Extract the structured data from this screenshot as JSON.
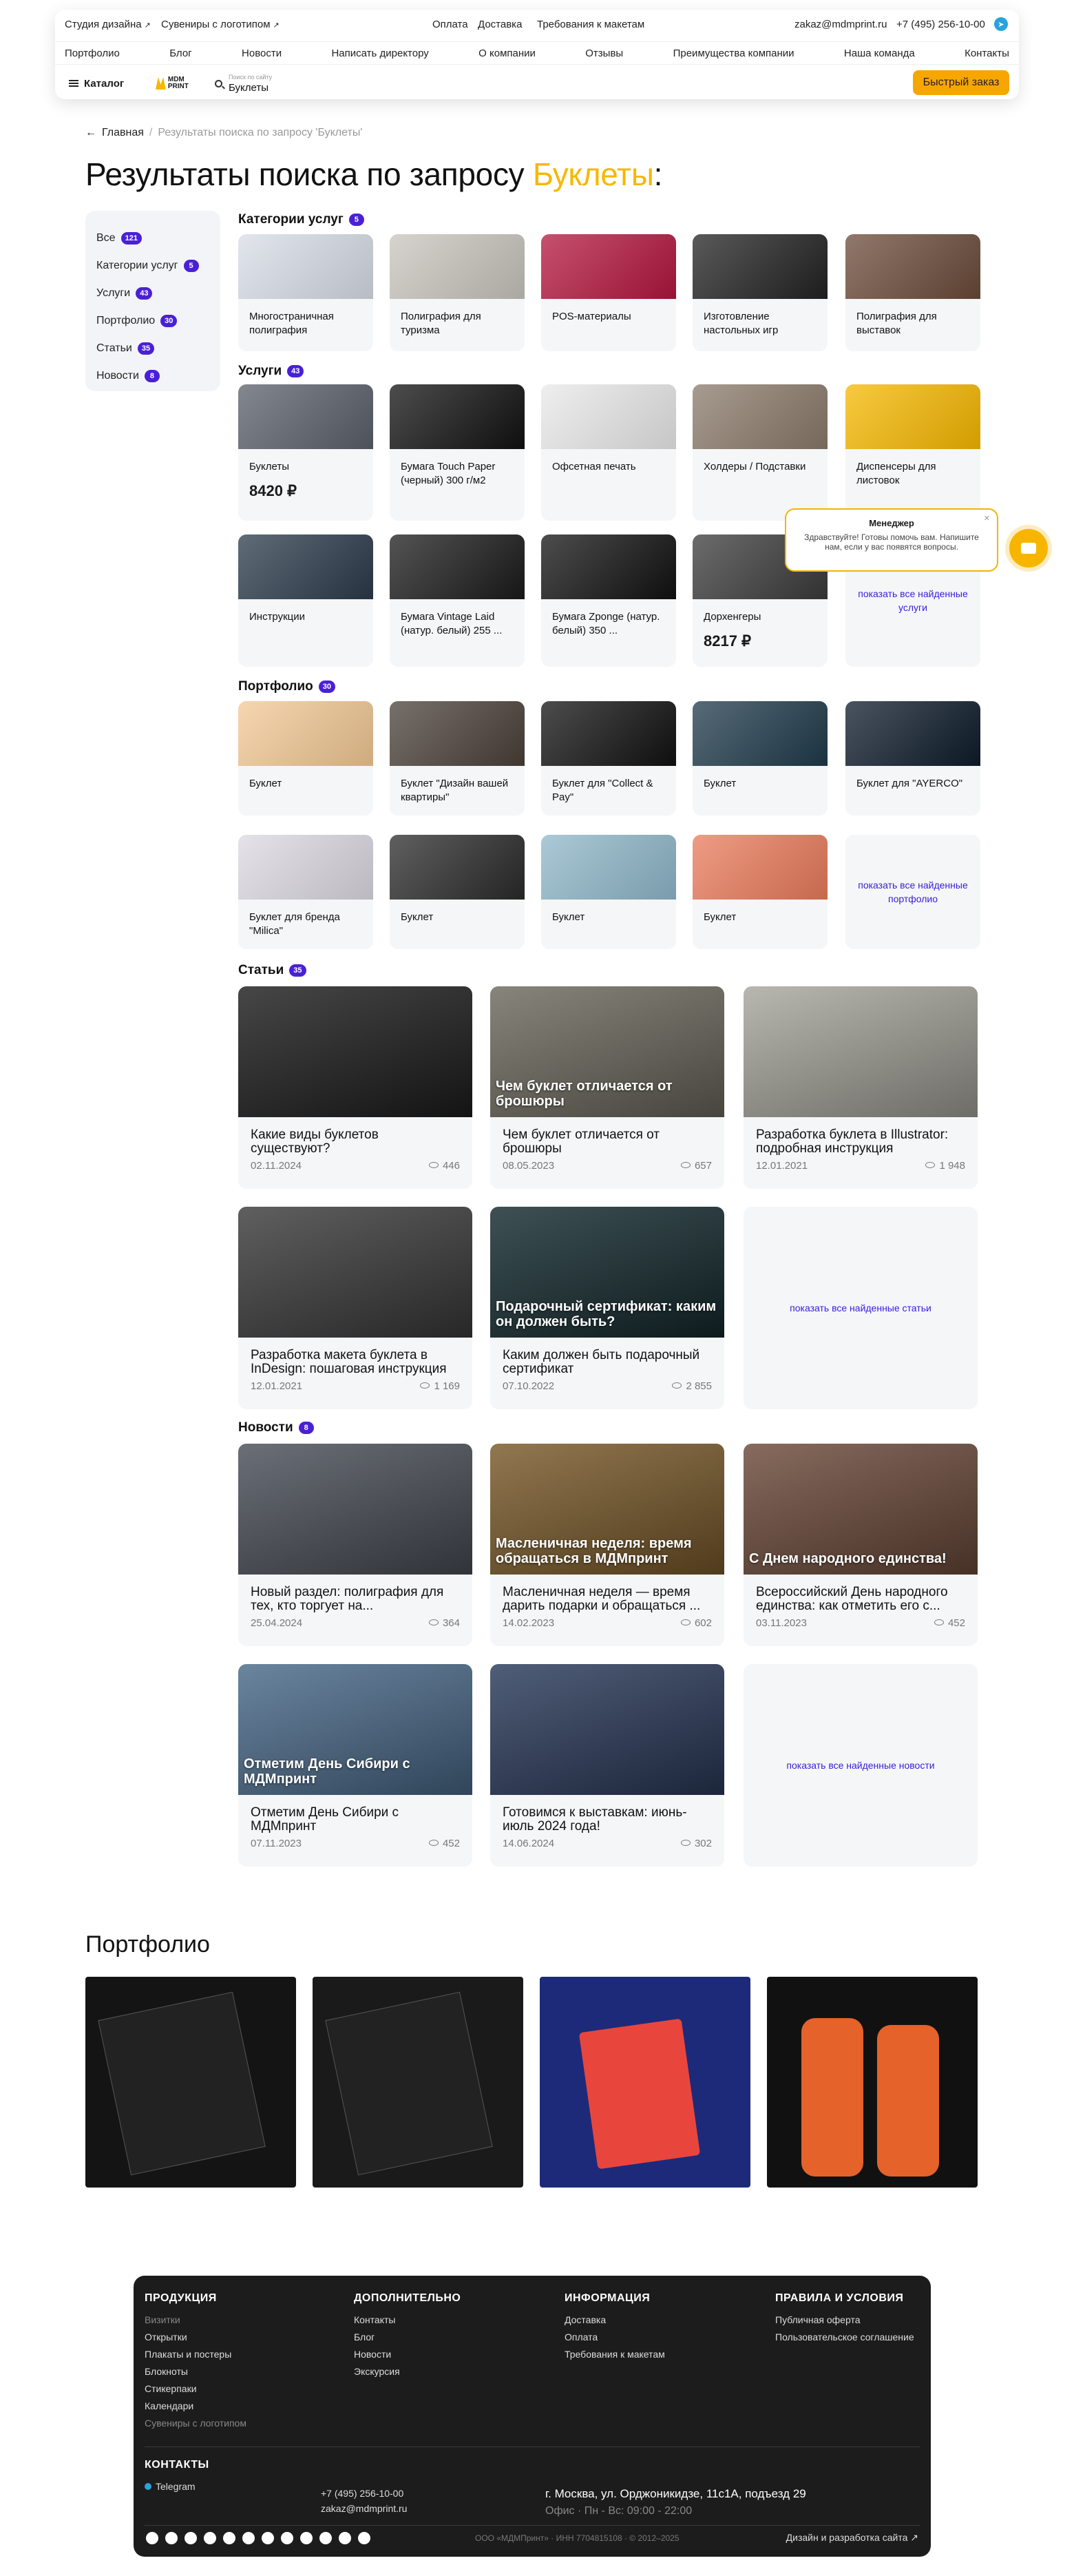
{
  "header": {
    "top_links": [
      "Студия дизайна",
      "Сувениры с логотипом"
    ],
    "center_links": [
      "Оплата",
      "Доставка",
      "Требования к макетам"
    ],
    "email": "zakaz@mdmprint.ru",
    "phone": "+7 (495) 256-10-00",
    "nav": [
      "Портфолио",
      "Блог",
      "Новости",
      "Написать директору",
      "О компании",
      "Отзывы",
      "Преимущества компании",
      "Наша команда",
      "Контакты"
    ],
    "catalog_label": "Каталог",
    "logo_text": "MDM PRINT",
    "search_placeholder": "Поиск по сайту",
    "search_value": "Буклеты",
    "quick_order": "Быстрый заказ"
  },
  "breadcrumb": {
    "home": "Главная",
    "current": "Результаты поиска по запросу 'Буклеты'"
  },
  "title": {
    "prefix": "Результаты поиска по запросу",
    "query": "Буклеты",
    "suffix": ":"
  },
  "filter": [
    {
      "label": "Все",
      "count": "121"
    },
    {
      "label": "Категории услуг",
      "count": "5"
    },
    {
      "label": "Услуги",
      "count": "43"
    },
    {
      "label": "Портфолио",
      "count": "30"
    },
    {
      "label": "Статьи",
      "count": "35"
    },
    {
      "label": "Новости",
      "count": "8"
    }
  ],
  "sections": {
    "categories": {
      "label": "Категории услуг",
      "count": "5"
    },
    "services": {
      "label": "Услуги",
      "count": "43"
    },
    "portfolio": {
      "label": "Портфолио",
      "count": "30"
    },
    "articles": {
      "label": "Статьи",
      "count": "35"
    },
    "news": {
      "label": "Новости",
      "count": "8"
    }
  },
  "categories": [
    {
      "title": "Многостраничная полиграфия",
      "color": "#d8dde6"
    },
    {
      "title": "Полиграфия для туризма",
      "color": "#c9c5be"
    },
    {
      "title": "POS-материалы",
      "color": "#b3163e"
    },
    {
      "title": "Изготовление настольных игр",
      "color": "#222222"
    },
    {
      "title": "Полиграфия для выставок",
      "color": "#6b4b3a"
    }
  ],
  "services": [
    {
      "title": "Буклеты",
      "price": "8420 ₽",
      "color": "#5a5f6a"
    },
    {
      "title": "Бумага Touch Paper (черный) 300 г/м2",
      "price": "",
      "color": "#111111"
    },
    {
      "title": "Офсетная печать",
      "price": "",
      "color": "#e9e9ea"
    },
    {
      "title": "Холдеры / Подставки",
      "price": "",
      "color": "#8a7a6a"
    },
    {
      "title": "Диспенсеры для листовок",
      "price": "",
      "color": "#f6b800"
    },
    {
      "title": "Инструкции",
      "price": "",
      "color": "#2b3a4a"
    },
    {
      "title": "Бумага Vintage Laid (натур. белый) 255 ...",
      "price": "",
      "color": "#1a1a1a"
    },
    {
      "title": "Бумага Zponge (натур. белый) 350 ...",
      "price": "",
      "color": "#111111"
    },
    {
      "title": "Дорхенгеры",
      "price": "8217 ₽",
      "color": "#3a3a3a"
    }
  ],
  "services_more": "показать все найденные услуги",
  "portfolio": [
    {
      "title": "Буклет",
      "color": "#f3c995"
    },
    {
      "title": "Буклет \"Дизайн вашей квартиры\"",
      "color": "#4a4038"
    },
    {
      "title": "Буклет для \"Collect & Pay\"",
      "color": "#111111"
    },
    {
      "title": "Буклет",
      "color": "#1f3a4a"
    },
    {
      "title": "Буклет для \"AYERCO\"",
      "color": "#0d1b2a"
    },
    {
      "title": "Буклет для бренда \"Milica\"",
      "color": "#dcd9e2"
    },
    {
      "title": "Буклет",
      "color": "#2a2a2a"
    },
    {
      "title": "Буклет",
      "color": "#8fb7c9"
    },
    {
      "title": "Буклет",
      "color": "#e97b5b"
    }
  ],
  "portfolio_more": "показать все найденные портфолио",
  "articles": [
    {
      "title": "Какие виды буклетов существуют?",
      "date": "02.11.2024",
      "views": "446",
      "overlay": "",
      "color": "#1e1e1e"
    },
    {
      "title": "Чем буклет отличается от брошюры",
      "date": "08.05.2023",
      "views": "657",
      "overlay": "Чем буклет отличается от брошюры",
      "color": "#6d6a5e"
    },
    {
      "title": "Разработка буклета в Illustrator: подробная инструкция",
      "date": "12.01.2021",
      "views": "1 948",
      "overlay": "",
      "color": "#a8a79e"
    },
    {
      "title": "Разработка макета буклета в InDesign: пошаговая инструкция",
      "date": "12.01.2021",
      "views": "1 169",
      "overlay": "",
      "color": "#3c3c3c"
    },
    {
      "title": "Каким должен быть подарочный сертификат",
      "date": "07.10.2022",
      "views": "2 855",
      "overlay": "Подарочный сертификат: каким он должен быть?",
      "color": "#142a2e"
    }
  ],
  "articles_more": "показать все найденные статьи",
  "news": [
    {
      "title": "Новый раздел: полиграфия для тех, кто торгует на...",
      "date": "25.04.2024",
      "views": "364",
      "overlay": "",
      "color": "#4a4f58"
    },
    {
      "title": "Масленичная неделя — время дарить подарки и обращаться ...",
      "date": "14.02.2023",
      "views": "602",
      "overlay": "Масленичная неделя: время обращаться в МДМпринт",
      "color": "#7a5a2a"
    },
    {
      "title": "Всероссийский День народного единства: как отметить его с...",
      "date": "03.11.2023",
      "views": "452",
      "overlay": "С Днем народного единства!",
      "color": "#6c4a3a"
    },
    {
      "title": "Отметим День Сибири с МДМпринт",
      "date": "07.11.2023",
      "views": "452",
      "overlay": "Отметим День Сибири с МДМпринт",
      "color": "#4a6a8a"
    },
    {
      "title": "Готовимся к выставкам: июнь-июль 2024 года!",
      "date": "14.06.2024",
      "views": "302",
      "overlay": "",
      "color": "#2a3a5a"
    }
  ],
  "news_more": "показать все найденные новости",
  "chat": {
    "title": "Менеджер",
    "message": "Здравствуйте! Готовы помочь вам. Напишите нам, если у вас появятся вопросы."
  },
  "portfolio_gallery": {
    "title": "Портфолио",
    "items": [
      {
        "name": "collect-exchange",
        "color": "#141414"
      },
      {
        "name": "collect-st",
        "color": "#1a1a1a"
      },
      {
        "name": "cards-54",
        "color": "#1d2a7a"
      },
      {
        "name": "bottles",
        "color": "#111111"
      }
    ]
  },
  "footer": {
    "cols": [
      {
        "title": "ПРОДУКЦИЯ",
        "links": [
          "Визитки",
          "Открытки",
          "Плакаты и постеры",
          "Блокноты",
          "Стикерпаки",
          "Календари",
          "Сувениры с логотипом"
        ]
      },
      {
        "title": "ДОПОЛНИТЕЛЬНО",
        "links": [
          "Контакты",
          "Блог",
          "Новости",
          "Экскурсия"
        ]
      },
      {
        "title": "ИНФОРМАЦИЯ",
        "links": [
          "Доставка",
          "Оплата",
          "Требования к макетам"
        ]
      },
      {
        "title": "ПРАВИЛА И УСЛОВИЯ",
        "links": [
          "Публичная оферта",
          "Пользовательское соглашение"
        ]
      }
    ],
    "contacts_title": "КОНТАКТЫ",
    "telegram": "Telegram",
    "phone": "+7 (495) 256-10-00",
    "email": "zakaz@mdmprint.ru",
    "address": "г. Москва, ул. Орджоникидзе, 11с1А, подъезд 29",
    "hours": "Офис · Пн - Вс: 09:00 - 22:00",
    "legal": "ООО «МДМПринт» · ИНН 7704815108 · © 2012–2025",
    "dev": "Дизайн и разработка сайта"
  }
}
